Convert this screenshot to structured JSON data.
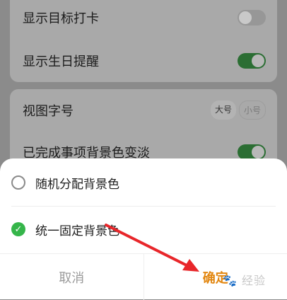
{
  "settings": {
    "rows": [
      {
        "label": "显示目标打卡",
        "toggle": "off"
      },
      {
        "label": "显示生日提醒",
        "toggle": "on"
      },
      {
        "label": "视图字号",
        "options": [
          "大号",
          "小号"
        ],
        "selected": "大号"
      },
      {
        "label": "已完成事项背景色变淡",
        "toggle": "on"
      }
    ]
  },
  "sheet": {
    "options": [
      {
        "label": "随机分配背景色",
        "checked": false
      },
      {
        "label": "统一固定背景色",
        "checked": true
      }
    ],
    "cancel_label": "取消",
    "confirm_label": "确定"
  },
  "watermark": "经验",
  "colors": {
    "toggle_on": "#2b6e33",
    "check_green": "#35b54a",
    "confirm_orange": "#e2860f",
    "arrow_red": "#e8262a"
  }
}
